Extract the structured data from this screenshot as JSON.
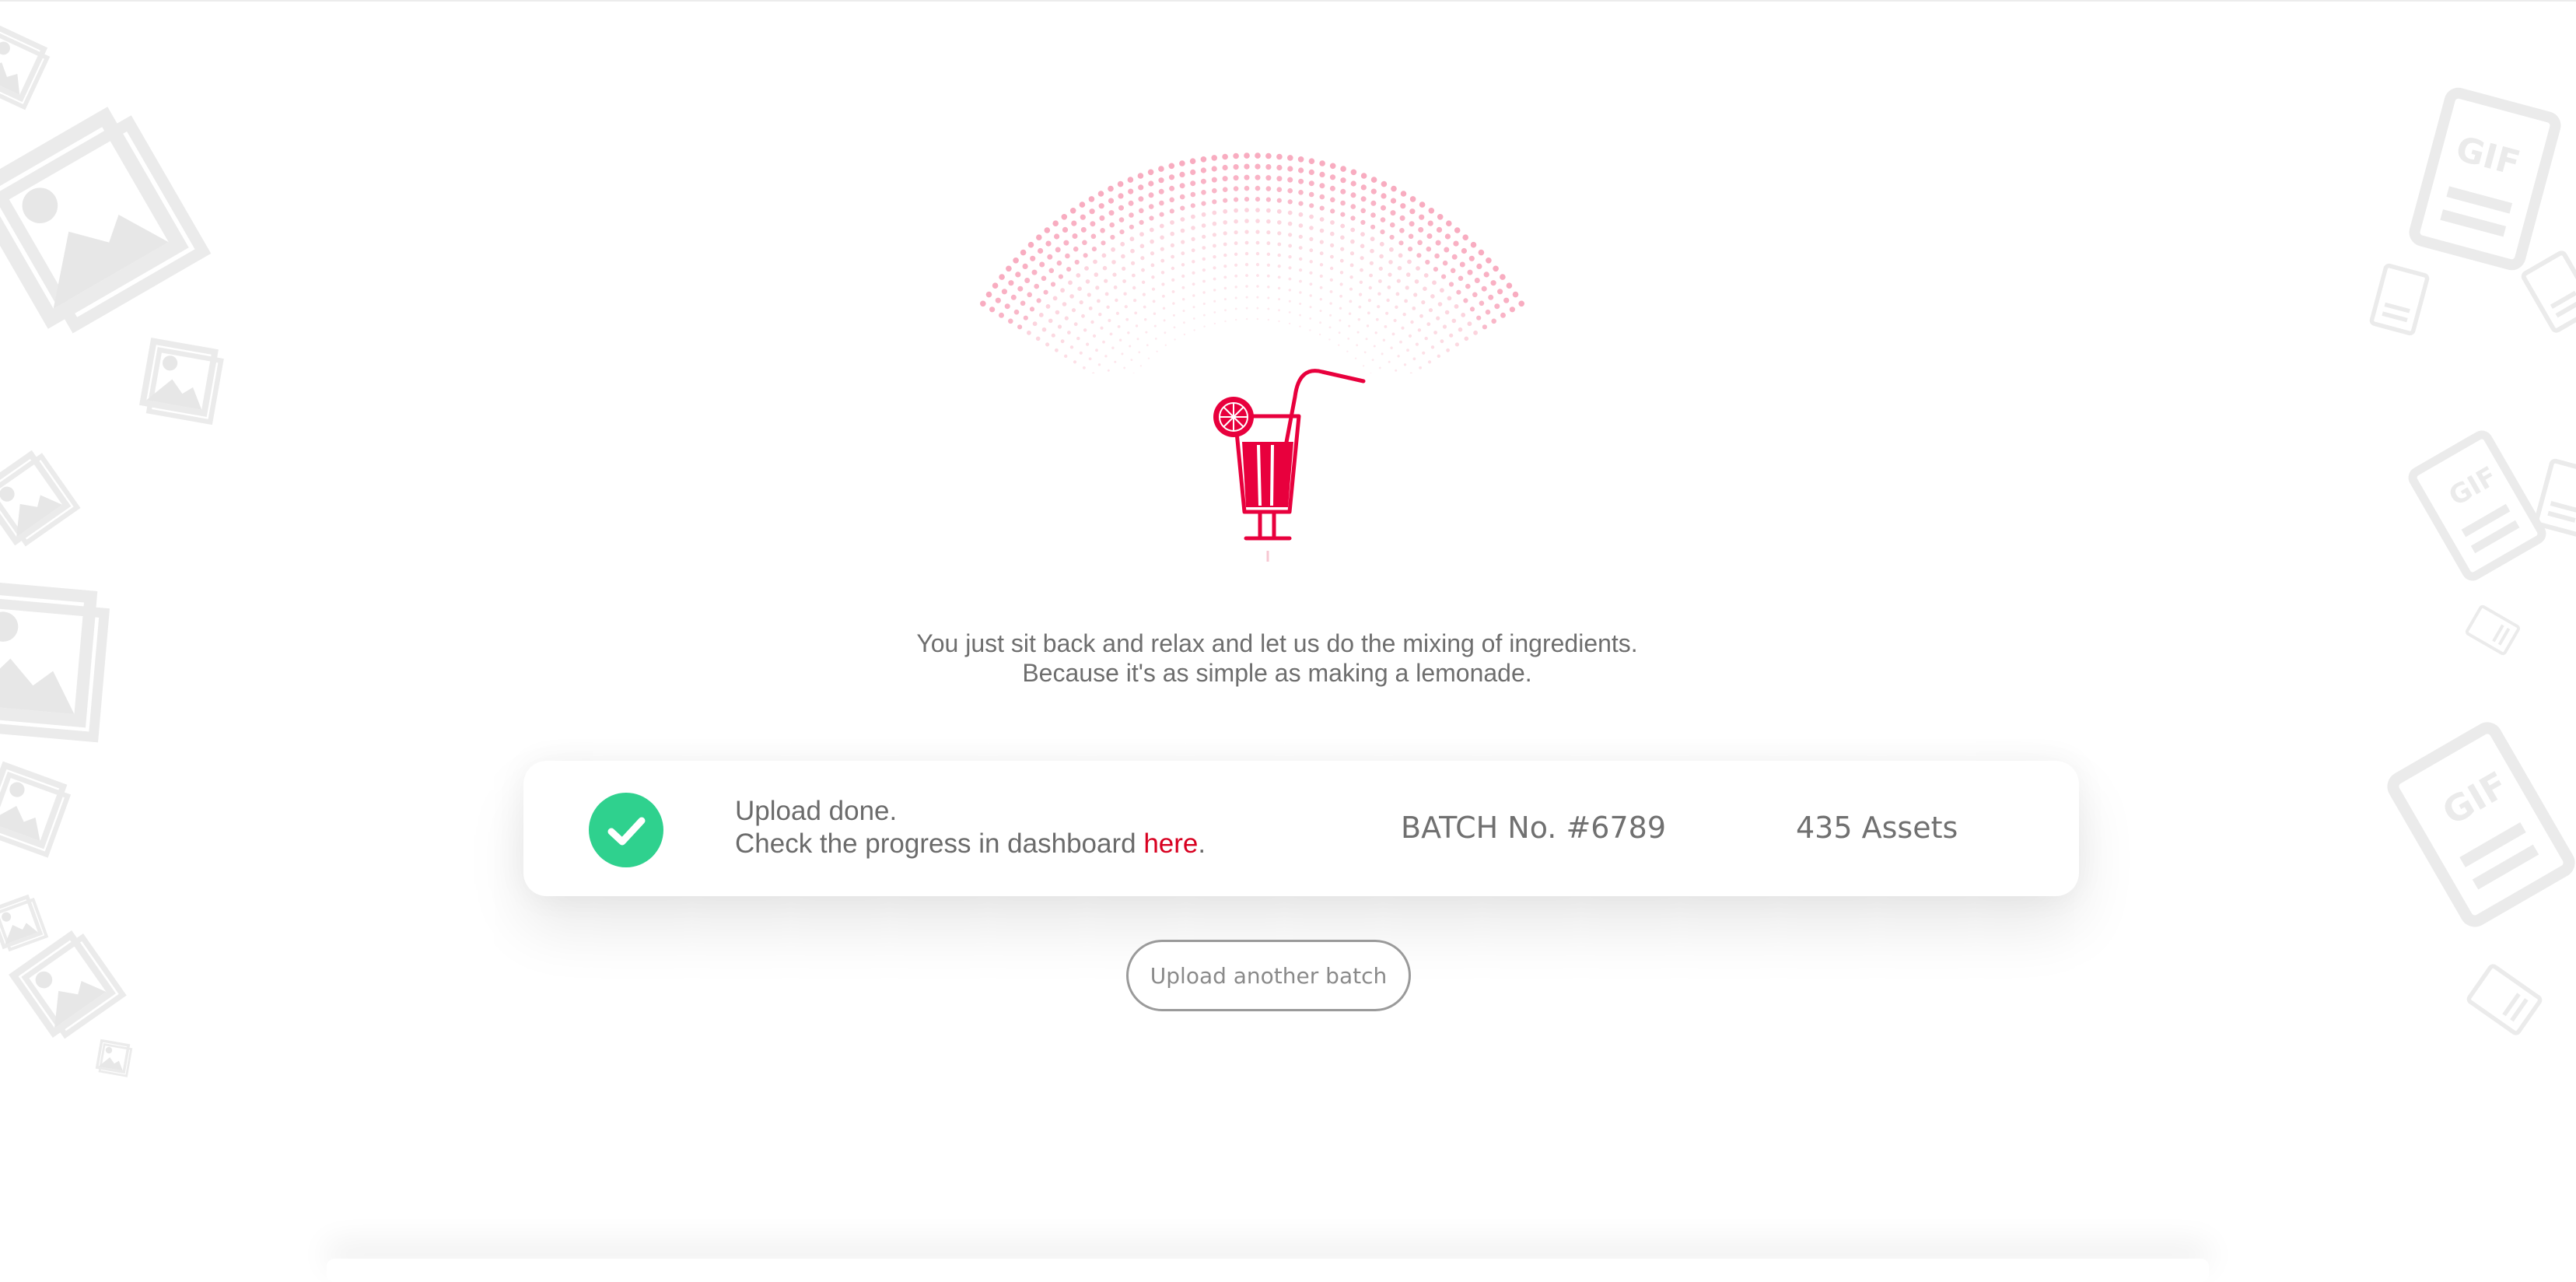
{
  "tagline": {
    "line1": "You just sit back and relax and let us do the mixing of ingredients.",
    "line2": "Because it's as simple as making a lemonade."
  },
  "status": {
    "title": "Upload done.",
    "progress_prefix": "Check the progress in dashboard ",
    "link_label": "here",
    "progress_suffix": ".",
    "batch_label": "BATCH No. #6789",
    "assets_label": "435 Assets",
    "status_icon": "check-icon"
  },
  "actions": {
    "upload_another_label": "Upload another batch"
  },
  "decor": {
    "gif_label": "GIF",
    "icons": [
      "image-stack-icon",
      "gif-file-icon",
      "cocktail-icon"
    ]
  },
  "colors": {
    "accent": "#e8003d",
    "success": "#2fd18e",
    "text": "#6e6e6e",
    "link": "#d80020",
    "decor": "#ededed"
  }
}
